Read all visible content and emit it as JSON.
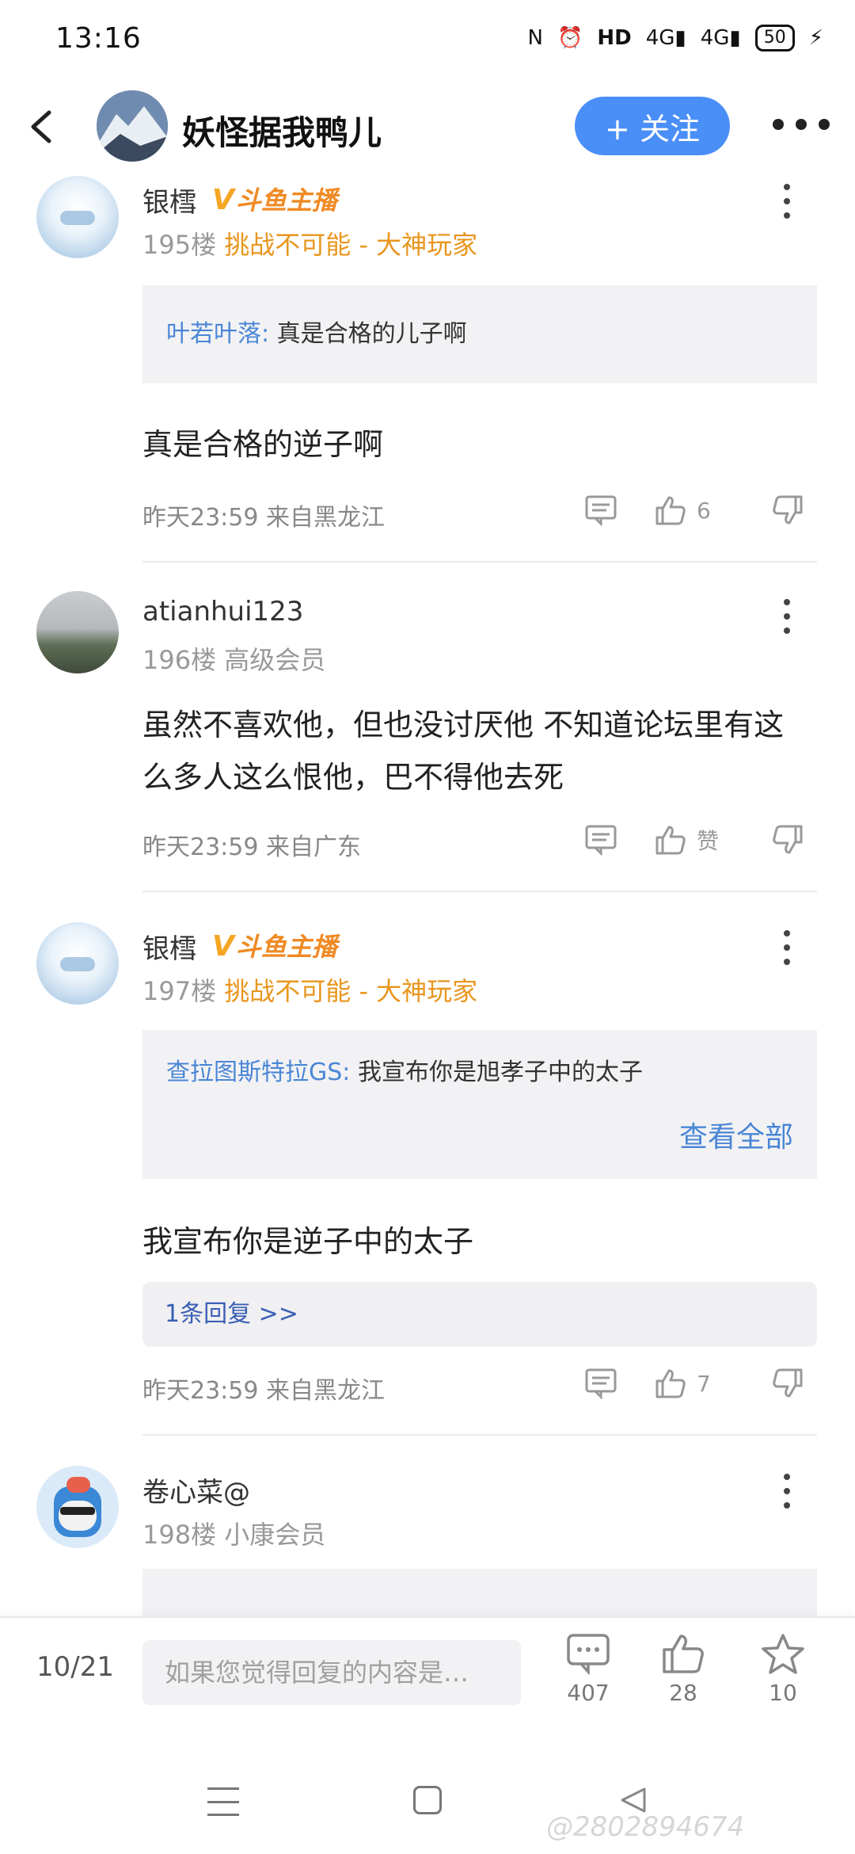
{
  "status_bar": {
    "time": "13:16",
    "network1": "4G",
    "network2": "4G",
    "battery": "50"
  },
  "header": {
    "title": "妖怪据我鸭儿",
    "follow_label": "+ 关注"
  },
  "posts": [
    {
      "username": "银樰",
      "badge": "斗鱼主播",
      "floor": "195楼",
      "tag": "挑战不可能 - 大神玩家",
      "quote_author": "叶若叶落:",
      "quote_text": "真是合格的儿子啊",
      "content": "真是合格的逆子啊",
      "meta": "昨天23:59 来自黑龙江",
      "like_count": "6"
    },
    {
      "username": "atianhui123",
      "floor": "196楼",
      "tag": "高级会员",
      "content": "虽然不喜欢他，但也没讨厌他      不知道论坛里有这么多人这么恨他，巴不得他去死",
      "meta": "昨天23:59 来自广东",
      "like_count": "赞"
    },
    {
      "username": "银樰",
      "badge": "斗鱼主播",
      "floor": "197楼",
      "tag": "挑战不可能 - 大神玩家",
      "quote_author": "查拉图斯特拉GS:",
      "quote_text": "我宣布你是旭孝子中的太子",
      "see_all": "查看全部",
      "content": "我宣布你是逆子中的太子",
      "reply_link": "1条回复 >>",
      "meta": "昨天23:59 来自黑龙江",
      "like_count": "7"
    },
    {
      "username": "卷心菜@",
      "floor": "198楼",
      "tag": "小康会员"
    }
  ],
  "bottom_bar": {
    "page": "10/21",
    "input_placeholder": "如果您觉得回复的内容是…",
    "comments": "407",
    "likes": "28",
    "favorites": "10"
  },
  "nav": {
    "watermark": "@2802894674"
  }
}
